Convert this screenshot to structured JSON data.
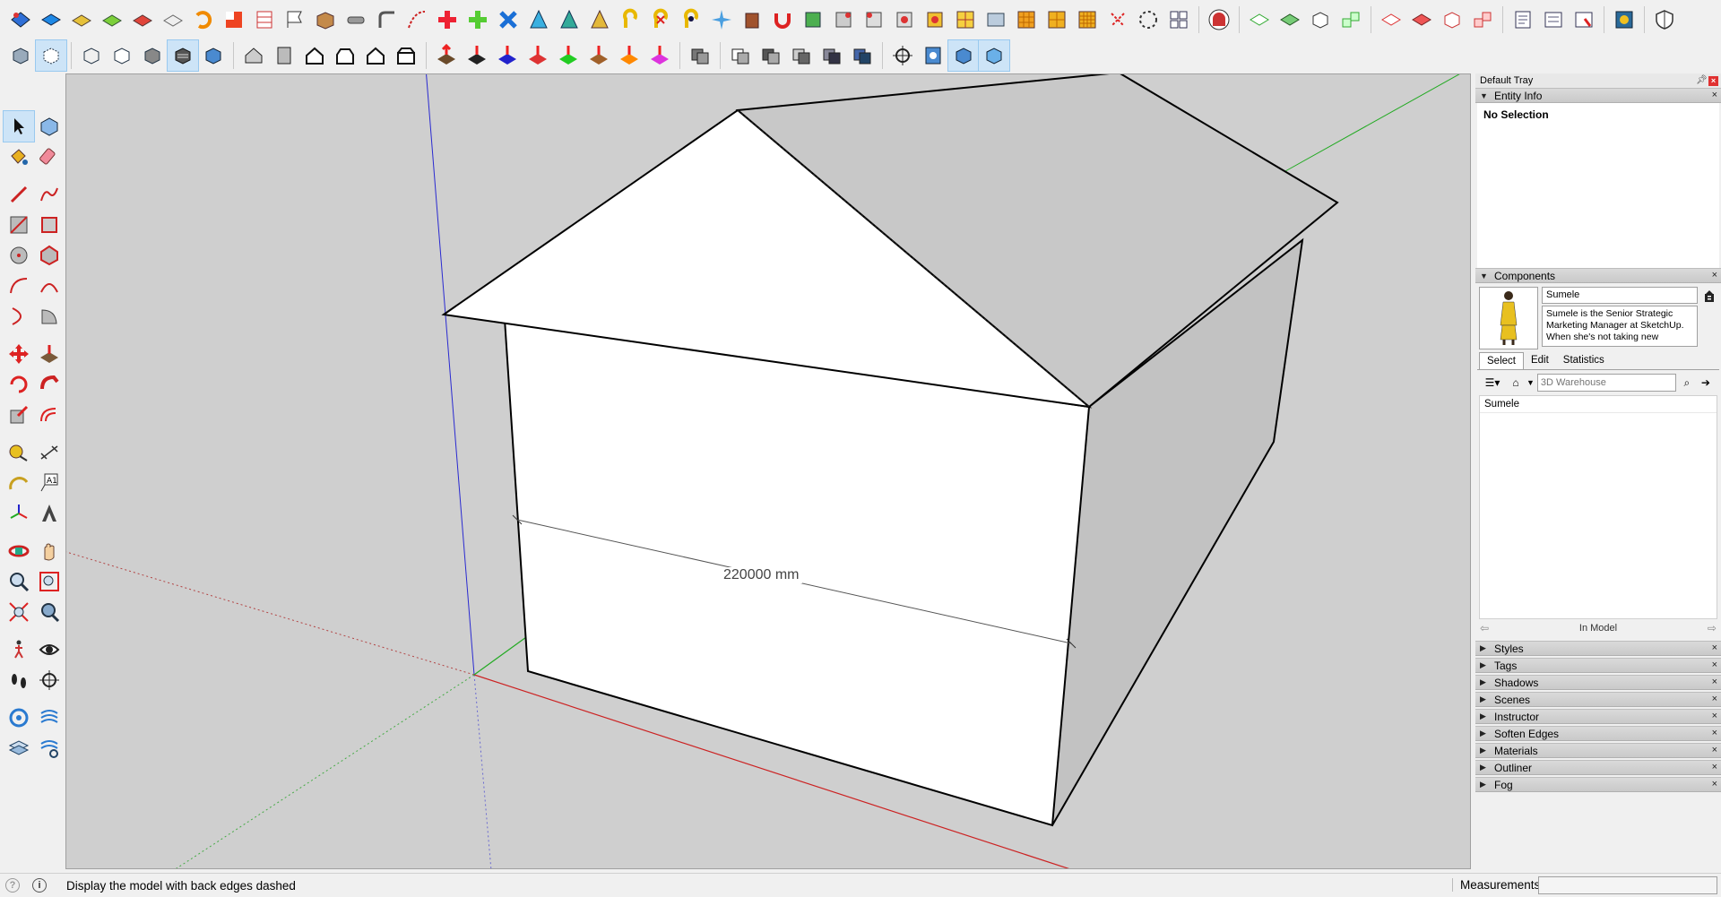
{
  "app": {
    "status_text": "Display the model with back edges dashed",
    "measurements_label": "Measurements"
  },
  "viewport": {
    "dimension_label": "220000 mm"
  },
  "tray": {
    "title": "Default Tray",
    "entity_info": {
      "label": "Entity Info",
      "selection": "No Selection"
    },
    "components": {
      "label": "Components",
      "name": "Sumele",
      "description": "Sumele is the Senior Strategic Marketing Manager at SketchUp. When she's not taking new",
      "tabs": [
        "Select",
        "Edit",
        "Statistics"
      ],
      "search_placeholder": "3D Warehouse",
      "items": [
        "Sumele"
      ],
      "nav_label": "In Model"
    },
    "panels": [
      "Styles",
      "Tags",
      "Shadows",
      "Scenes",
      "Instructor",
      "Soften Edges",
      "Materials",
      "Outliner",
      "Fog"
    ]
  },
  "colors": {
    "viewport_bg": "#cfcfcf",
    "axis_red": "#cc2222",
    "axis_green": "#22aa22",
    "axis_blue": "#2222cc",
    "active_tool": "#cde4f7"
  }
}
